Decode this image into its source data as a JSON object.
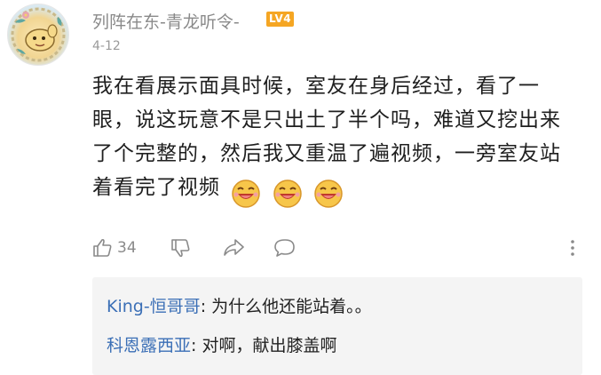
{
  "comment": {
    "username": "列阵在东-青龙听令-",
    "level_badge": "LV4",
    "date": "4-12",
    "text": "我在看展示面具时候，室友在身后经过，看了一眼，说这玩意不是只出土了半个吗，难道又挖出来了个完整的，然后我又重温了遍视频，一旁室友站着看完了视频",
    "emojis": [
      "laughing-face-emoji",
      "laughing-face-emoji",
      "laughing-face-emoji"
    ],
    "like_count": "34"
  },
  "actions": {
    "icons": [
      "thumbs-up-icon",
      "thumbs-down-icon",
      "share-icon",
      "comment-icon",
      "more-vertical-icon"
    ]
  },
  "replies": [
    {
      "author": "King-恒哥哥",
      "separator": ": ",
      "text": "为什么他还能站着。。"
    },
    {
      "author": "科恩露西亚",
      "separator": ": ",
      "text": "对啊，献出膝盖啊"
    }
  ],
  "colors": {
    "reply_author": "#3b6fb6",
    "level_badge": "#f5a623",
    "meta_text": "#8a8a8a",
    "reply_background": "#f4f4f4"
  }
}
